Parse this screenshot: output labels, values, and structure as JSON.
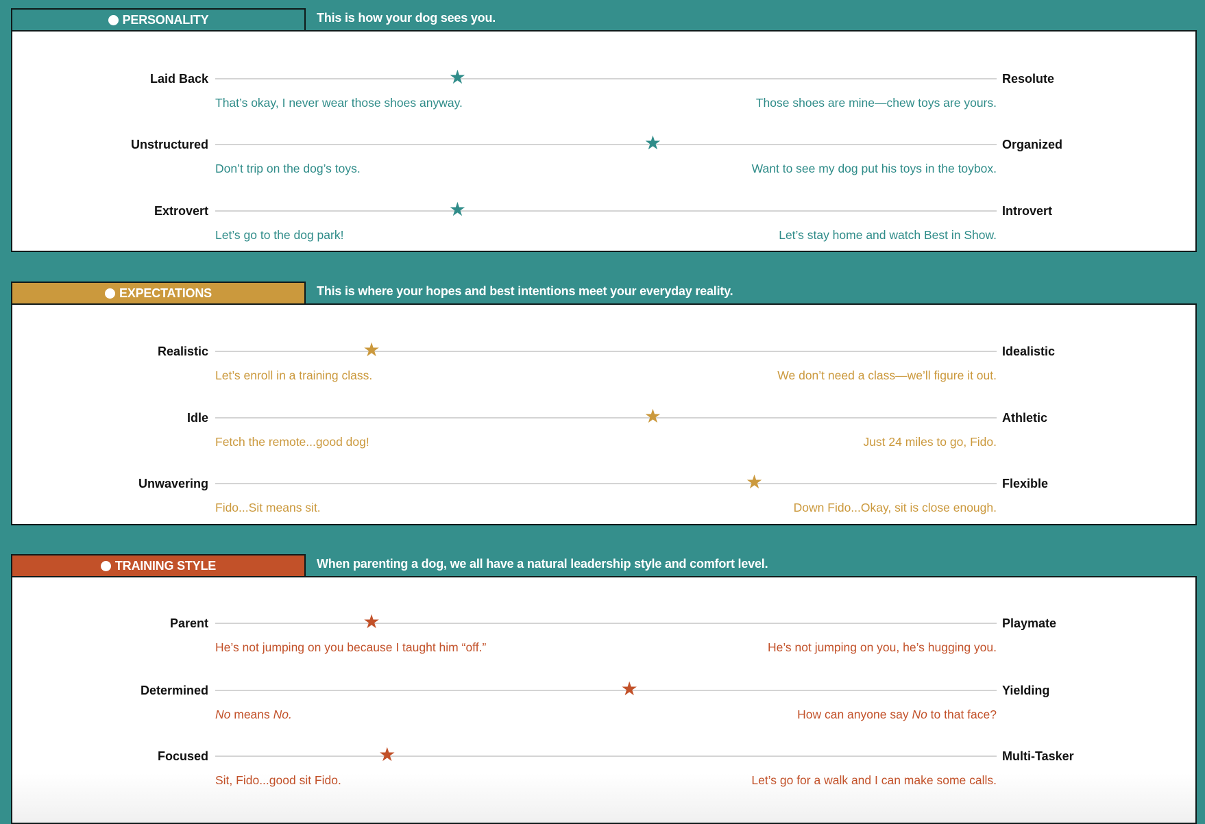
{
  "sections": [
    {
      "title": "PERSONALITY",
      "subtitle": "This is how your dog sees you.",
      "accent": "#358f8c",
      "icon": "info-icon",
      "rows": [
        {
          "left_label": "Laid Back",
          "right_label": "Resolute",
          "left_desc": "That’s okay, I never wear those shoes anyway.",
          "right_desc": "Those shoes are mine—chew toys are yours.",
          "position": 0.31
        },
        {
          "left_label": "Unstructured",
          "right_label": "Organized",
          "left_desc": "Don’t trip on the dog’s toys.",
          "right_desc": "Want to see my dog put his toys in the toybox.",
          "position": 0.56
        },
        {
          "left_label": "Extrovert",
          "right_label": "Introvert",
          "left_desc": "Let’s go to the dog park!",
          "right_desc": "Let’s stay home and watch Best in Show.",
          "position": 0.31
        }
      ]
    },
    {
      "title": "EXPECTATIONS",
      "subtitle": "This is where your hopes and best intentions meet your everyday reality.",
      "accent": "#cb993d",
      "icon": "info-icon",
      "rows": [
        {
          "left_label": "Realistic",
          "right_label": "Idealistic",
          "left_desc": "Let’s enroll in a training class.",
          "right_desc": "We don’t need a class—we’ll figure it out.",
          "position": 0.2
        },
        {
          "left_label": "Idle",
          "right_label": "Athletic",
          "left_desc": "Fetch the remote...good dog!",
          "right_desc": "Just 24 miles to go, Fido.",
          "position": 0.56
        },
        {
          "left_label": "Unwavering",
          "right_label": "Flexible",
          "left_desc": "Fido...Sit means sit.",
          "right_desc": "Down Fido...Okay, sit is close enough.",
          "position": 0.69
        }
      ]
    },
    {
      "title": "TRAINING STYLE",
      "subtitle": "When parenting a dog, we all have a natural leadership style and comfort level.",
      "accent": "#c25129",
      "icon": "info-icon",
      "rows": [
        {
          "left_label": "Parent",
          "right_label": "Playmate",
          "left_desc": "He’s not jumping on you because I taught him “off.”",
          "right_desc": "He’s not jumping on you, he’s hugging you.",
          "position": 0.2
        },
        {
          "left_label": "Determined",
          "right_label": "Yielding",
          "left_desc_parts": [
            "No",
            " means ",
            "No."
          ],
          "right_desc_parts": [
            "How can anyone say ",
            "No",
            " to that face?"
          ],
          "position": 0.53
        },
        {
          "left_label": "Focused",
          "right_label": "Multi-Tasker",
          "left_desc": "Sit, Fido...good sit Fido.",
          "right_desc": "Let’s go for a walk and I can make some calls.",
          "position": 0.22
        }
      ]
    }
  ]
}
